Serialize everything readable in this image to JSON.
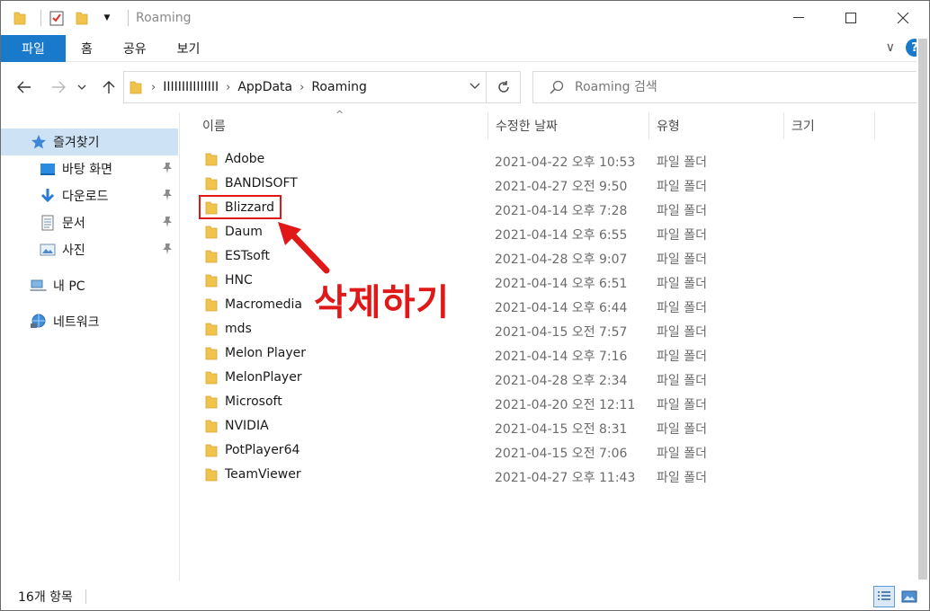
{
  "window": {
    "title": "Roaming"
  },
  "ribbon": {
    "tabs": [
      "파일",
      "홈",
      "공유",
      "보기"
    ]
  },
  "address": {
    "crumbs": [
      "IIIIIIIIIIIIIII",
      "AppData",
      "Roaming"
    ]
  },
  "search": {
    "placeholder": "Roaming 검색"
  },
  "navpane": {
    "quick_access": "즐겨찾기",
    "items": [
      {
        "label": "바탕 화면",
        "icon": "desktop-icon",
        "pinned": true
      },
      {
        "label": "다운로드",
        "icon": "download-icon",
        "pinned": true
      },
      {
        "label": "문서",
        "icon": "document-icon",
        "pinned": true
      },
      {
        "label": "사진",
        "icon": "picture-icon",
        "pinned": true
      }
    ],
    "this_pc": "내 PC",
    "network": "네트워크"
  },
  "columns": {
    "name": "이름",
    "date": "수정한 날짜",
    "type": "유형",
    "size": "크기"
  },
  "files": [
    {
      "name": "Adobe",
      "date": "2021-04-22 오후 10:53",
      "type": "파일 폴더"
    },
    {
      "name": "BANDISOFT",
      "date": "2021-04-27 오전 9:50",
      "type": "파일 폴더"
    },
    {
      "name": "Blizzard",
      "date": "2021-04-14 오후 7:28",
      "type": "파일 폴더"
    },
    {
      "name": "Daum",
      "date": "2021-04-14 오후 6:55",
      "type": "파일 폴더"
    },
    {
      "name": "ESTsoft",
      "date": "2021-04-28 오후 9:07",
      "type": "파일 폴더"
    },
    {
      "name": "HNC",
      "date": "2021-04-14 오후 6:51",
      "type": "파일 폴더"
    },
    {
      "name": "Macromedia",
      "date": "2021-04-14 오후 6:44",
      "type": "파일 폴더"
    },
    {
      "name": "mds",
      "date": "2021-04-15 오전 7:57",
      "type": "파일 폴더"
    },
    {
      "name": "Melon Player",
      "date": "2021-04-14 오후 7:16",
      "type": "파일 폴더"
    },
    {
      "name": "MelonPlayer",
      "date": "2021-04-28 오후 2:34",
      "type": "파일 폴더"
    },
    {
      "name": "Microsoft",
      "date": "2021-04-20 오전 12:11",
      "type": "파일 폴더"
    },
    {
      "name": "NVIDIA",
      "date": "2021-04-15 오전 8:31",
      "type": "파일 폴더"
    },
    {
      "name": "PotPlayer64",
      "date": "2021-04-15 오전 7:06",
      "type": "파일 폴더"
    },
    {
      "name": "TeamViewer",
      "date": "2021-04-27 오후 11:43",
      "type": "파일 폴더"
    }
  ],
  "annotation": {
    "text": "삭제하기",
    "highlighted_item": "Blizzard"
  },
  "statusbar": {
    "count": "16개 항목"
  },
  "colors": {
    "accent": "#1979ca",
    "annotation": "#e01818",
    "folder": "#f0c44c"
  }
}
